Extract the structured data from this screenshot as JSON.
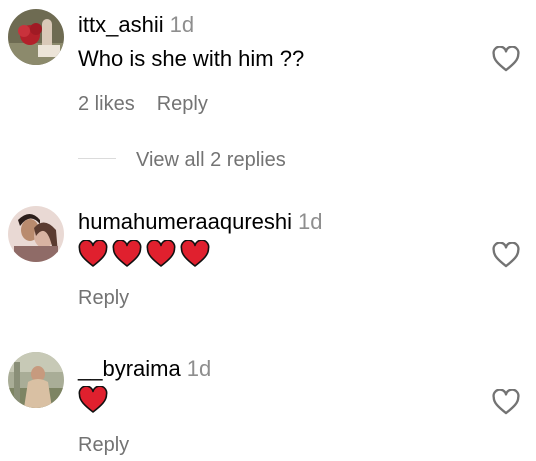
{
  "comments": [
    {
      "username": "ittx_ashii",
      "time": "1d",
      "text": "Who is she with him ??",
      "likes_label": "2 likes",
      "reply_label": "Reply",
      "view_replies_label": "View all 2 replies",
      "avatar": "avatar-roses-photo"
    },
    {
      "username": "humahumeraaqureshi",
      "time": "1d",
      "text": "",
      "emoji": [
        "red-heart",
        "red-heart",
        "red-heart",
        "red-heart"
      ],
      "reply_label": "Reply",
      "avatar": "avatar-couple-photo"
    },
    {
      "username": "__byraima",
      "time": "1d",
      "text": "",
      "emoji": [
        "red-heart"
      ],
      "reply_label": "Reply",
      "avatar": "avatar-outdoor-photo"
    }
  ],
  "icons": {
    "like": "heart-outline-icon",
    "emoji": "red-heart-emoji"
  },
  "colors": {
    "username": "#000000",
    "secondary_text": "#737373",
    "time": "#8e8e8e",
    "emoji_heart": "#e0202e",
    "like_icon": "#737373"
  }
}
